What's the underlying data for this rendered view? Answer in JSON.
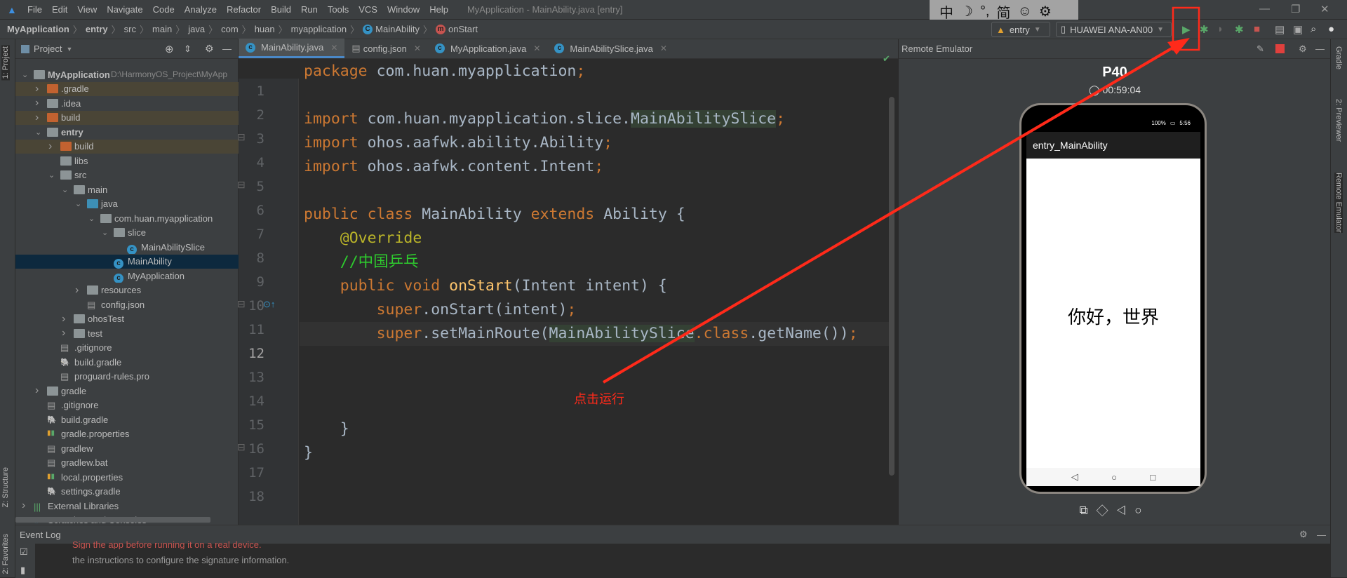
{
  "menubar": {
    "items": [
      "File",
      "Edit",
      "View",
      "Navigate",
      "Code",
      "Analyze",
      "Refactor",
      "Build",
      "Run",
      "Tools",
      "VCS",
      "Window",
      "Help"
    ],
    "window_title": "MyApplication - MainAbility.java [entry]"
  },
  "ime_toolbar": {
    "items": [
      "中",
      "☽",
      "°,",
      "简",
      "☺",
      "⚙"
    ]
  },
  "breadcrumb": [
    "MyApplication",
    "entry",
    "src",
    "main",
    "java",
    "com",
    "huan",
    "myapplication",
    "MainAbility",
    "onStart"
  ],
  "toolbar": {
    "config": "entry",
    "device": "HUAWEI ANA-AN00"
  },
  "project": {
    "title": "Project",
    "tree": [
      {
        "label": "MyApplication",
        "path": "D:\\HarmonyOS_Project\\MyApp",
        "level": 0,
        "arrow": "down",
        "icon": "module",
        "bold": true
      },
      {
        "label": ".gradle",
        "level": 1,
        "arrow": "right",
        "icon": "folder-orange",
        "bg": "brown"
      },
      {
        "label": ".idea",
        "level": 1,
        "arrow": "right",
        "icon": "folder"
      },
      {
        "label": "build",
        "level": 1,
        "arrow": "right",
        "icon": "folder-orange",
        "bg": "brown"
      },
      {
        "label": "entry",
        "level": 1,
        "arrow": "down",
        "icon": "module",
        "bold": true
      },
      {
        "label": "build",
        "level": 2,
        "arrow": "right",
        "icon": "folder-orange",
        "bg": "brown"
      },
      {
        "label": "libs",
        "level": 2,
        "arrow": "",
        "icon": "folder"
      },
      {
        "label": "src",
        "level": 2,
        "arrow": "down",
        "icon": "folder"
      },
      {
        "label": "main",
        "level": 3,
        "arrow": "down",
        "icon": "folder"
      },
      {
        "label": "java",
        "level": 4,
        "arrow": "down",
        "icon": "folder-blue"
      },
      {
        "label": "com.huan.myapplication",
        "level": 5,
        "arrow": "down",
        "icon": "package"
      },
      {
        "label": "slice",
        "level": 6,
        "arrow": "down",
        "icon": "package"
      },
      {
        "label": "MainAbilitySlice",
        "level": 7,
        "arrow": "",
        "icon": "class"
      },
      {
        "label": "MainAbility",
        "level": 6,
        "arrow": "",
        "icon": "class",
        "bg": "sel"
      },
      {
        "label": "MyApplication",
        "level": 6,
        "arrow": "",
        "icon": "class"
      },
      {
        "label": "resources",
        "level": 4,
        "arrow": "right",
        "icon": "folder"
      },
      {
        "label": "config.json",
        "level": 4,
        "arrow": "",
        "icon": "file"
      },
      {
        "label": "ohosTest",
        "level": 3,
        "arrow": "right",
        "icon": "folder"
      },
      {
        "label": "test",
        "level": 3,
        "arrow": "right",
        "icon": "folder"
      },
      {
        "label": ".gitignore",
        "level": 2,
        "arrow": "",
        "icon": "file"
      },
      {
        "label": "build.gradle",
        "level": 2,
        "arrow": "",
        "icon": "gradle"
      },
      {
        "label": "proguard-rules.pro",
        "level": 2,
        "arrow": "",
        "icon": "file"
      },
      {
        "label": "gradle",
        "level": 1,
        "arrow": "right",
        "icon": "folder"
      },
      {
        "label": ".gitignore",
        "level": 1,
        "arrow": "",
        "icon": "file"
      },
      {
        "label": "build.gradle",
        "level": 1,
        "arrow": "",
        "icon": "gradle"
      },
      {
        "label": "gradle.properties",
        "level": 1,
        "arrow": "",
        "icon": "props"
      },
      {
        "label": "gradlew",
        "level": 1,
        "arrow": "",
        "icon": "file"
      },
      {
        "label": "gradlew.bat",
        "level": 1,
        "arrow": "",
        "icon": "file"
      },
      {
        "label": "local.properties",
        "level": 1,
        "arrow": "",
        "icon": "props"
      },
      {
        "label": "settings.gradle",
        "level": 1,
        "arrow": "",
        "icon": "gradle"
      },
      {
        "label": "External Libraries",
        "level": 0,
        "arrow": "right",
        "icon": "libs"
      },
      {
        "label": "Scratches and Consoles",
        "level": 0,
        "arrow": "",
        "icon": "scratch"
      }
    ]
  },
  "side_tabs": {
    "project": "1: Project",
    "structure": "Z: Structure",
    "favorites": "2: Favorites",
    "gradle": "Gradle",
    "previewer": "2: Previewer",
    "remote_emulator": "Remote Emulator"
  },
  "editor": {
    "tabs": [
      {
        "label": "MainAbility.java",
        "icon": "class",
        "active": true
      },
      {
        "label": "config.json",
        "icon": "file"
      },
      {
        "label": "MyApplication.java",
        "icon": "class"
      },
      {
        "label": "MainAbilitySlice.java",
        "icon": "class"
      }
    ],
    "current_line": 12,
    "lines": [
      [
        [
          "k",
          "package "
        ],
        [
          "t",
          "com.huan.myapplication"
        ],
        [
          "k",
          ";"
        ]
      ],
      [],
      [
        [
          "k",
          "import "
        ],
        [
          "t",
          "com.huan.myapplication.slice."
        ],
        [
          "hl",
          "MainAbilitySlice"
        ],
        [
          "k",
          ";"
        ]
      ],
      [
        [
          "k",
          "import "
        ],
        [
          "t",
          "ohos.aafwk.ability.Ability"
        ],
        [
          "k",
          ";"
        ]
      ],
      [
        [
          "k",
          "import "
        ],
        [
          "t",
          "ohos.aafwk.content.Intent"
        ],
        [
          "k",
          ";"
        ]
      ],
      [],
      [
        [
          "k",
          "public class "
        ],
        [
          "t",
          "MainAbility "
        ],
        [
          "k",
          "extends "
        ],
        [
          "t",
          "Ability {"
        ]
      ],
      [
        [
          "t",
          "    "
        ],
        [
          "a",
          "@Override"
        ]
      ],
      [
        [
          "t",
          "    "
        ],
        [
          "c",
          "//中国乒乓"
        ]
      ],
      [
        [
          "t",
          "    "
        ],
        [
          "k",
          "public void "
        ],
        [
          "f",
          "onStart"
        ],
        [
          "t",
          "(Intent intent) {"
        ]
      ],
      [
        [
          "t",
          "        "
        ],
        [
          "k",
          "super"
        ],
        [
          "t",
          ".onStart(intent)"
        ],
        [
          "k",
          ";"
        ]
      ],
      [
        [
          "t",
          "        "
        ],
        [
          "k",
          "super"
        ],
        [
          "t",
          ".setMainRoute("
        ],
        [
          "hl",
          "MainAbilitySlice"
        ],
        [
          "k",
          ".class"
        ],
        [
          "t",
          ".getName())"
        ],
        [
          "k",
          ";"
        ]
      ],
      [],
      [],
      [],
      [
        [
          "t",
          "    }"
        ]
      ],
      [
        [
          "t",
          "}"
        ]
      ],
      []
    ]
  },
  "emulator": {
    "title": "Remote Emulator",
    "device_name": "P40",
    "timer": "00:59:04",
    "status_battery": "100%",
    "status_time": "5:56",
    "app_title": "entry_MainAbility",
    "screen_text": "你好，世界"
  },
  "annotation": {
    "label": "点击运行",
    "color": "#ff2a1a"
  },
  "event_log": {
    "title": "Event Log",
    "lines": [
      "Sign the app before running it on a real device.",
      "the instructions to configure the signature information."
    ]
  }
}
